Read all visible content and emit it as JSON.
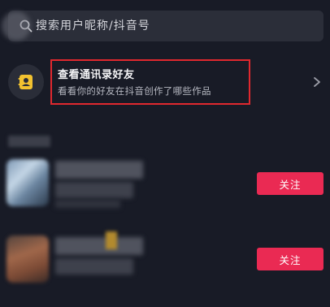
{
  "search": {
    "placeholder": "搜索用户昵称/抖音号"
  },
  "contacts_entry": {
    "title": "查看通讯录好友",
    "subtitle": "看看你的好友在抖音创作了哪些作品",
    "highlight_color": "#e0282e"
  },
  "suggested_users": [
    {
      "follow_label": "关注"
    },
    {
      "follow_label": "关注"
    }
  ],
  "colors": {
    "background": "#181b26",
    "accent": "#ea2a53"
  }
}
